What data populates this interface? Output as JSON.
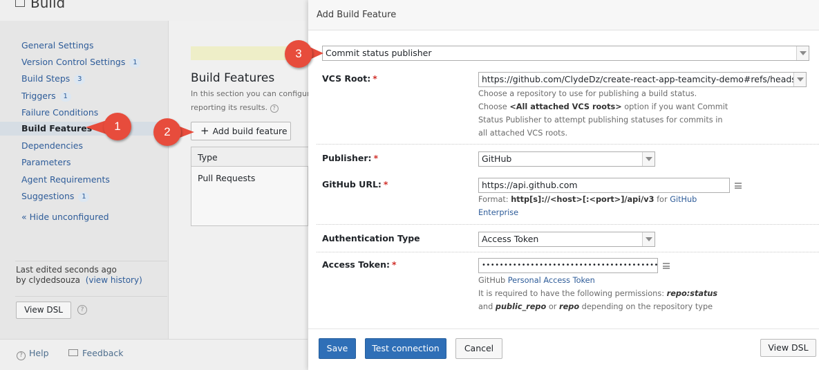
{
  "page": {
    "title": "Build",
    "sidebar": {
      "items": [
        {
          "label": "General Settings",
          "badge": ""
        },
        {
          "label": "Version Control Settings",
          "badge": "1"
        },
        {
          "label": "Build Steps",
          "badge": "3"
        },
        {
          "label": "Triggers",
          "badge": "1"
        },
        {
          "label": "Failure Conditions",
          "badge": ""
        },
        {
          "label": "Build Features",
          "badge": ""
        },
        {
          "label": "Dependencies",
          "badge": ""
        },
        {
          "label": "Parameters",
          "badge": ""
        },
        {
          "label": "Agent Requirements",
          "badge": ""
        },
        {
          "label": "Suggestions",
          "badge": "1"
        }
      ],
      "hide_unconfigured": "« Hide unconfigured",
      "last_edited_line1": "Last edited seconds ago",
      "last_edited_by": "by clydedsouza",
      "view_history": "(view history)",
      "view_dsl": "View DSL"
    },
    "main": {
      "heading": "Build Features",
      "desc_line1": "In this section you can configure",
      "desc_line2": "reporting its results.",
      "add_button": "Add build feature",
      "table_header": "Type",
      "table_row": "Pull Requests"
    },
    "footer": {
      "help": "Help",
      "feedback": "Feedback"
    }
  },
  "markers": {
    "one": "1",
    "two": "2",
    "three": "3"
  },
  "dialog": {
    "title": "Add Build Feature",
    "feature_select": "Commit status publisher",
    "vcs_root": {
      "label": "VCS Root:",
      "required": "*",
      "value": "https://github.com/ClydeDz/create-react-app-teamcity-demo#refs/heads/main",
      "note1": "Choose a repository to use for publishing a build status.",
      "note2_pre": "Choose ",
      "note2_bold": "<All attached VCS roots>",
      "note2_post": " option if you want Commit",
      "note3": "Status Publisher to attempt publishing statuses for commits in",
      "note4": "all attached VCS roots."
    },
    "publisher": {
      "label": "Publisher:",
      "required": "*",
      "value": "GitHub"
    },
    "github_url": {
      "label": "GitHub URL:",
      "required": "*",
      "value": "https://api.github.com",
      "format_pre": "Format: ",
      "format_bold": "http[s]://<host>[:<port>]/api/v3",
      "format_post": " for ",
      "format_link": "GitHub",
      "format_link2": "Enterprise"
    },
    "auth_type": {
      "label": "Authentication Type",
      "value": "Access Token"
    },
    "access_token": {
      "label": "Access Token:",
      "required": "*",
      "value": "••••••••••••••••••••••••••••••••••••••••",
      "note1_pre": "GitHub ",
      "note1_link": "Personal Access Token",
      "note2_pre": "It is required to have the following permissions: ",
      "note2_bold": "repo:status",
      "note3_pre": "and ",
      "note3_bold1": "public_repo",
      "note3_mid": " or ",
      "note3_bold2": "repo",
      "note3_post": " depending on the repository type"
    },
    "buttons": {
      "save": "Save",
      "test": "Test connection",
      "cancel": "Cancel",
      "view_dsl": "View DSL"
    }
  },
  "colors": {
    "accent": "#2f6fb7",
    "marker": "#e74c3c",
    "link": "#2e5c99"
  }
}
